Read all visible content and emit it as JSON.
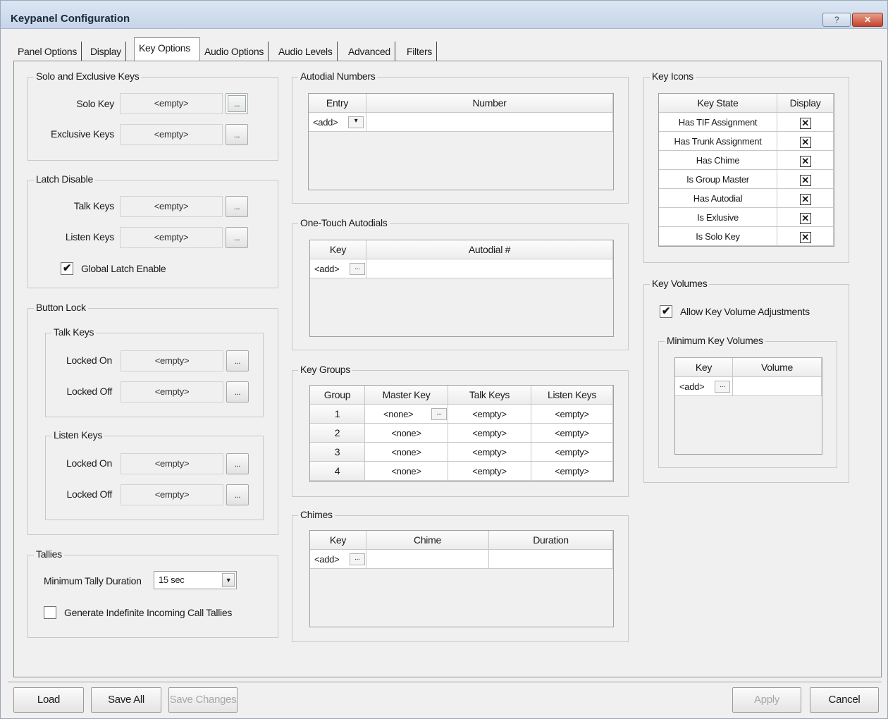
{
  "window": {
    "title": "Keypanel Configuration",
    "help_label": "?",
    "close_label": "✕"
  },
  "tabs": [
    "Panel Options",
    "Display",
    "Key Options",
    "Audio Options",
    "Audio Levels",
    "Advanced",
    "Filters"
  ],
  "active_tab": "Key Options",
  "empty_value": "<empty>",
  "browse_label": "...",
  "solo_exclusive": {
    "title": "Solo and Exclusive Keys",
    "solo_label": "Solo Key",
    "exclusive_label": "Exclusive Keys"
  },
  "latch_disable": {
    "title": "Latch Disable",
    "talk_label": "Talk Keys",
    "listen_label": "Listen Keys",
    "global_latch_label": "Global Latch Enable",
    "global_latch_checked": true
  },
  "button_lock": {
    "title": "Button Lock",
    "talk_title": "Talk Keys",
    "listen_title": "Listen Keys",
    "locked_on_label": "Locked On",
    "locked_off_label": "Locked Off"
  },
  "tallies": {
    "title": "Tallies",
    "min_duration_label": "Minimum Tally Duration",
    "min_duration_value": "15 sec",
    "indefinite_label": "Generate Indefinite Incoming Call Tallies",
    "indefinite_checked": false
  },
  "autodial_numbers": {
    "title": "Autodial Numbers",
    "headers": [
      "Entry",
      "Number"
    ],
    "add_label": "<add>"
  },
  "one_touch": {
    "title": "One-Touch Autodials",
    "headers": [
      "Key",
      "Autodial #"
    ],
    "add_label": "<add>"
  },
  "key_groups": {
    "title": "Key Groups",
    "headers": [
      "Group",
      "Master Key",
      "Talk Keys",
      "Listen Keys"
    ],
    "rows": [
      [
        "1",
        "<none>",
        "<empty>",
        "<empty>"
      ],
      [
        "2",
        "<none>",
        "<empty>",
        "<empty>"
      ],
      [
        "3",
        "<none>",
        "<empty>",
        "<empty>"
      ],
      [
        "4",
        "<none>",
        "<empty>",
        "<empty>"
      ]
    ]
  },
  "chimes": {
    "title": "Chimes",
    "headers": [
      "Key",
      "Chime",
      "Duration"
    ],
    "add_label": "<add>"
  },
  "key_icons": {
    "title": "Key Icons",
    "headers": [
      "Key State",
      "Display"
    ],
    "rows": [
      {
        "state": "Has TIF Assignment",
        "display": true
      },
      {
        "state": "Has Trunk Assignment",
        "display": true
      },
      {
        "state": "Has Chime",
        "display": true
      },
      {
        "state": "Is Group Master",
        "display": true
      },
      {
        "state": "Has Autodial",
        "display": true
      },
      {
        "state": "Is Exlusive",
        "display": true
      },
      {
        "state": "Is Solo Key",
        "display": true
      }
    ]
  },
  "key_volumes": {
    "title": "Key Volumes",
    "allow_label": "Allow Key Volume Adjustments",
    "allow_checked": true,
    "min_title": "Minimum Key Volumes",
    "headers": [
      "Key",
      "Volume"
    ],
    "add_label": "<add>"
  },
  "footer": {
    "load": "Load",
    "save_all": "Save All",
    "save_changes": "Save Changes",
    "apply": "Apply",
    "cancel": "Cancel"
  }
}
